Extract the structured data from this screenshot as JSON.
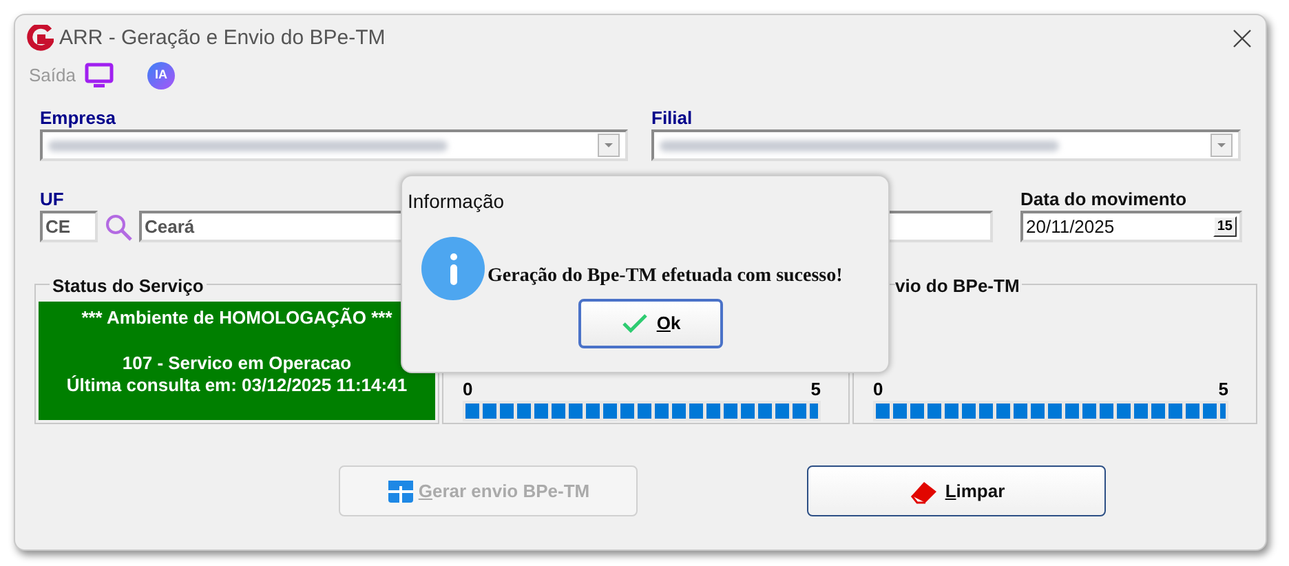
{
  "window": {
    "title": "ARR - Geração e Envio do BPe-TM"
  },
  "toolbar": {
    "exit_label": "Saída",
    "ai_badge": "IA"
  },
  "form": {
    "empresa": {
      "label": "Empresa"
    },
    "filial": {
      "label": "Filial"
    },
    "uf": {
      "label": "UF",
      "code": "CE",
      "name": "Ceará"
    },
    "date": {
      "label": "Data do movimento",
      "value": "20/11/2025",
      "calendar_glyph": "15"
    }
  },
  "status_panel": {
    "title": "Status do Serviço",
    "environment": "*** Ambiente de HOMOLOGAÇÃO ***",
    "service_status": "107 - Servico em Operacao",
    "last_check": "Última consulta em: 03/12/2025 11:14:41"
  },
  "progress_panels": [
    {
      "min": "0",
      "max": "5",
      "level": 1
    },
    {
      "title": "vio do BPe-TM",
      "min": "0",
      "max": "5",
      "level": 1
    }
  ],
  "buttons": [
    {
      "label": "Gerar envio BPe-TM",
      "kind": "grid",
      "disabled": true
    },
    {
      "label": "Limpar",
      "kind": "eraser",
      "disabled": false
    }
  ],
  "dialog": {
    "title": "Informação",
    "message": "Geração do Bpe-TM efetuada com sucesso!",
    "button": "Ok"
  }
}
